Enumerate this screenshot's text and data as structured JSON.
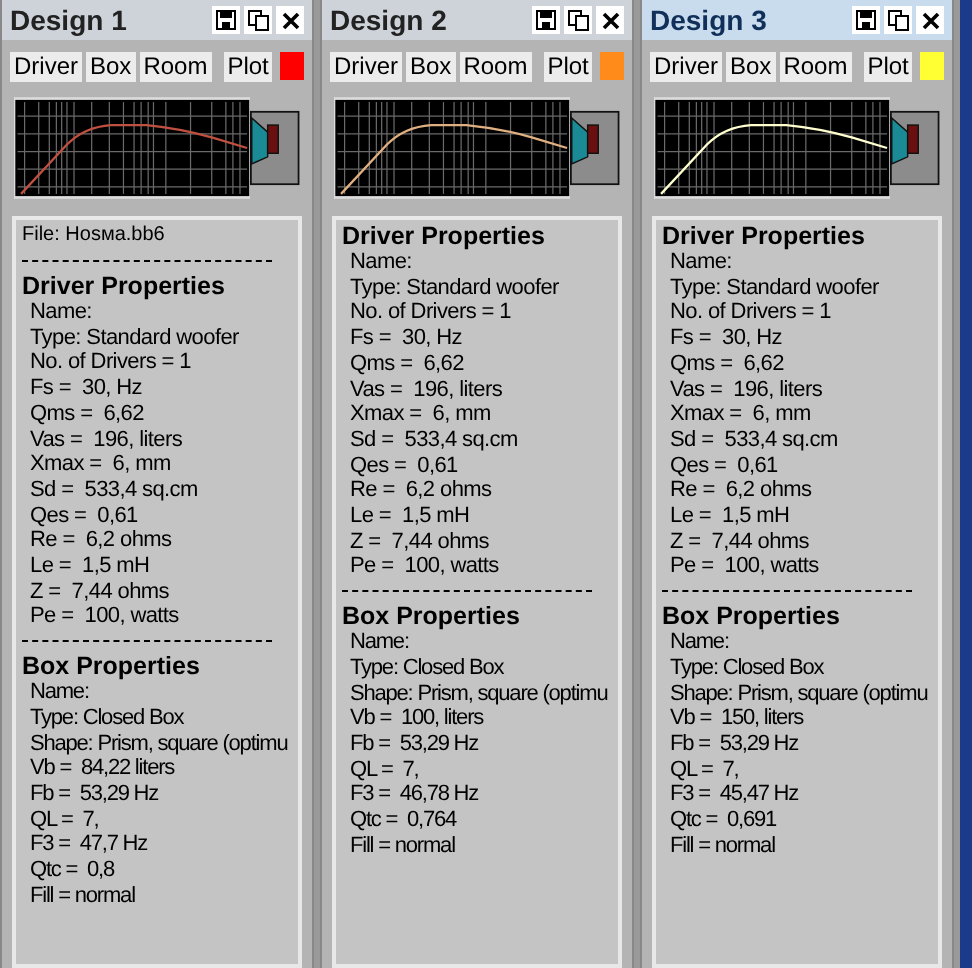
{
  "designs": [
    {
      "title": "Design 1",
      "selected": false,
      "tabs": [
        "Driver",
        "Box",
        "Room",
        "Plot"
      ],
      "color": "#ff0000",
      "file": "File: Hosма.bb6",
      "driver_heading": "Driver Properties",
      "driver_lines": [
        "Name:",
        "Type: Standard woofer",
        "No. of Drivers = 1",
        "Fs =  30, Hz",
        "Qms =  6,62",
        "Vas =  196, liters",
        "Xmax =  6, mm",
        "Sd =  533,4 sq.cm",
        "Qes =  0,61",
        "Re =  6,2 ohms",
        "Le =  1,5 mH",
        "Z =  7,44 ohms",
        "Pe =  100, watts"
      ],
      "box_heading": "Box Properties",
      "box_lines": [
        "Name:",
        "Type: Closed Box",
        "Shape: Prism, square (optimu",
        "Vb =  84,22 liters",
        "Fb =  53,29 Hz",
        "QL =  7,",
        "F3 =  47,7 Hz",
        "Qtc =  0,8",
        "Fill = normal"
      ]
    },
    {
      "title": "Design 2",
      "selected": false,
      "tabs": [
        "Driver",
        "Box",
        "Room",
        "Plot"
      ],
      "color": "#ff8c1a",
      "driver_heading": "Driver Properties",
      "driver_lines": [
        "Name:",
        "Type: Standard woofer",
        "No. of Drivers = 1",
        "Fs =  30, Hz",
        "Qms =  6,62",
        "Vas =  196, liters",
        "Xmax =  6, mm",
        "Sd =  533,4 sq.cm",
        "Qes =  0,61",
        "Re =  6,2 ohms",
        "Le =  1,5 mH",
        "Z =  7,44 ohms",
        "Pe =  100, watts"
      ],
      "box_heading": "Box Properties",
      "box_lines": [
        "Name:",
        "Type: Closed Box",
        "Shape: Prism, square (optimu",
        "Vb =  100, liters",
        "Fb =  53,29 Hz",
        "QL =  7,",
        "F3 =  46,78 Hz",
        "Qtc =  0,764",
        "Fill = normal"
      ]
    },
    {
      "title": "Design 3",
      "selected": true,
      "tabs": [
        "Driver",
        "Box",
        "Room",
        "Plot"
      ],
      "color": "#ffff33",
      "driver_heading": "Driver Properties",
      "driver_lines": [
        "Name:",
        "Type: Standard woofer",
        "No. of Drivers = 1",
        "Fs =  30, Hz",
        "Qms =  6,62",
        "Vas =  196, liters",
        "Xmax =  6, mm",
        "Sd =  533,4 sq.cm",
        "Qes =  0,61",
        "Re =  6,2 ohms",
        "Le =  1,5 mH",
        "Z =  7,44 ohms",
        "Pe =  100, watts"
      ],
      "box_heading": "Box Properties",
      "box_lines": [
        "Name:",
        "Type: Closed Box",
        "Shape: Prism, square (optimu",
        "Vb =  150, liters",
        "Fb =  53,29 Hz",
        "QL =  7,",
        "F3 =  45,47 Hz",
        "Qtc =  0,691",
        "Fill = normal"
      ]
    }
  ]
}
